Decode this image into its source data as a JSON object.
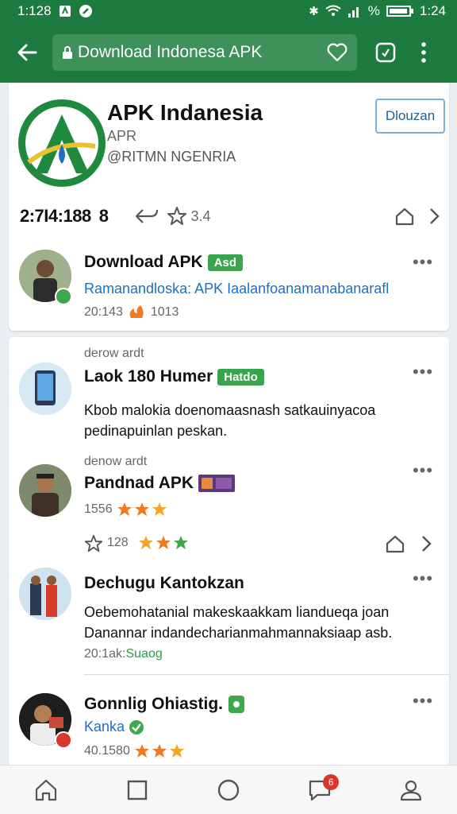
{
  "status_bar": {
    "time_left": "1:128",
    "battery_text": "%",
    "time_right": "1:24"
  },
  "browser": {
    "url_text": "Download Indonesa APK"
  },
  "profile": {
    "title": "APK Indanesia",
    "subtitle": "APR",
    "handle": "@RITMN NGENRIA",
    "follow_label": "Dlouzan",
    "stats_count": "2:7I4:188",
    "stats_num": "8",
    "stars_label": "3.4"
  },
  "posts": [
    {
      "title": "Download APK",
      "tag": "Asd",
      "link": "Ramanandloska: APK Iaalanfoanamanabanarafl",
      "meta": "20:143",
      "meta2": "1013"
    },
    {
      "label": "derow ardt",
      "title": "Laok 180 Humer",
      "tag": "Hatdo",
      "body1": "Kbob malokia doenomaasnash satkauinyacoa",
      "body2": "pedinapuinlan peskan."
    },
    {
      "label": "denow ardt",
      "title": "Pandnad APK",
      "meta": "1556",
      "likes": "128"
    },
    {
      "title": "Dechugu Kantokzan",
      "body1": "Oebemohatanial makeskaakkam liandueqa joan",
      "body2": "Danannar indandecharianmahmannaksiaap asb.",
      "meta": "20:1ak:",
      "meta_link": "Suaog"
    },
    {
      "title": "Gonnlig Ohiastig.",
      "link": "Kanka",
      "meta": "40.1580"
    }
  ],
  "nav": {
    "badge_count": "6"
  },
  "colors": {
    "brand_green": "#1e7b3f",
    "link_blue": "#1e6fc4",
    "star_orange": "#f5a623",
    "badge_red": "#d9372b"
  }
}
